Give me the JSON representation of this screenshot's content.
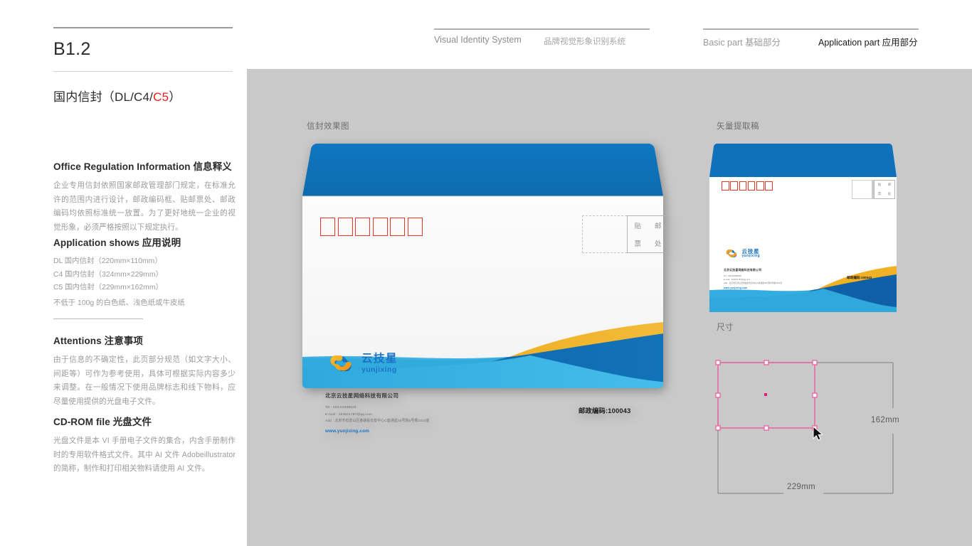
{
  "header": {
    "page_code": "B1.2",
    "section_title_cn": "国内信封（DL/C4/",
    "section_title_accent": "C5",
    "section_title_close": "）",
    "nav": {
      "system_en": "Visual Identity System",
      "system_cn": "品牌视觉形象识别系统",
      "basic_part": "Basic part  基础部分",
      "application_part": "Application part  应用部分"
    }
  },
  "sidebar": {
    "blocks": [
      {
        "id": "office-regulation",
        "heading": "Office Regulation Information 信息释义",
        "body": "企业专用信封依照国家邮政管理部门规定，在标准允许的范围内进行设计，邮政编码框、贴邮票处、邮政编码均依照标准统一放置。为了更好地统一企业的视觉形象，必须严格按照以下规定执行。"
      },
      {
        "id": "application-shows",
        "heading": "Application shows 应用说明",
        "specs": [
          "DL 国内信封（220mm×110mm）",
          "C4 国内信封（324mm×229mm）",
          "C5 国内信封（229mm×162mm）",
          "不低于 100g 的白色纸、浅色纸或牛皮纸"
        ]
      },
      {
        "id": "attentions",
        "heading": "Attentions 注意事项",
        "body": "由于信息的不确定性，此页部分规范（如文字大小、间距等）可作为参考使用，具体可根据实际内容多少来调整。在一般情况下使用品牌标志和线下物料，应尽量使用提供的光盘电子文件。"
      },
      {
        "id": "cdrom-file",
        "heading": "CD-ROM file 光盘文件",
        "body": "光盘文件是本 VI 手册电子文件的集合，内含手册制作时的专用软件格式文件。其中 AI 文件 Adobeillustrator 的简称，制作和打印相关物料请使用 AI 文件。"
      }
    ]
  },
  "canvas": {
    "mockup_label": "信封效果图",
    "vector_label": "矢量提取稿",
    "dimension_label": "尺寸"
  },
  "envelope": {
    "postal_boxes": 6,
    "stamp_chars": [
      "贴",
      "邮",
      "票",
      "处"
    ],
    "logo": {
      "cn": "云技星",
      "en": "yunjixing"
    },
    "company_name": "北京云技星网络科技有限公司",
    "contact_lines": [
      "Tel : 020-81958528",
      "E-mail : 324521787@qq.com",
      "Add : 北京市石景山区金融街长安中心C座通盈25号院5号楼2310室"
    ],
    "website": "www.yunjixing.com",
    "postcode": "邮政编码:100043"
  },
  "dimensions": {
    "width_label": "229mm",
    "height_label": "162mm"
  },
  "colors": {
    "brand_blue": "#0f71ba",
    "brand_deep_blue": "#1060a8",
    "brand_cyan": "#30a8dc",
    "brand_gold": "#f0b124",
    "accent_red": "#e2231a",
    "postal_red": "#e8372a",
    "canvas_grey": "#c9c9c9",
    "selection_pink": "#f0559a"
  }
}
